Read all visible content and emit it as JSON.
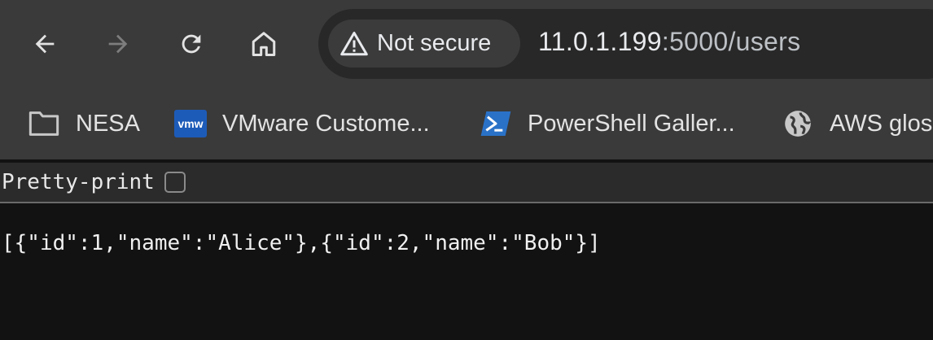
{
  "toolbar": {
    "back_icon": "back-arrow-icon",
    "forward_icon": "forward-arrow-icon",
    "reload_icon": "reload-icon",
    "home_icon": "home-icon"
  },
  "omnibox": {
    "security_label": "Not secure",
    "security_icon": "warning-triangle-icon",
    "url_host": "11.0.1.199",
    "url_rest": ":5000/users"
  },
  "bookmarks": [
    {
      "label": "NESA",
      "icon": "folder-icon"
    },
    {
      "label": "VMware Custome...",
      "icon": "vmware-icon",
      "icon_text": "vmw"
    },
    {
      "label": "PowerShell Galler...",
      "icon": "powershell-icon"
    },
    {
      "label": "AWS glos",
      "icon": "globe-icon"
    }
  ],
  "viewer": {
    "pretty_print_label": "Pretty-print",
    "pretty_print_checked": false,
    "json_text": "[{\"id\":1,\"name\":\"Alice\"},{\"id\":2,\"name\":\"Bob\"}]"
  },
  "colors": {
    "chrome_bg": "#3a3a3a",
    "omnibox_bg": "#282828",
    "content_bg": "#121212",
    "vmware_blue": "#1d5bb8",
    "powershell_blue": "#2a72c8"
  }
}
